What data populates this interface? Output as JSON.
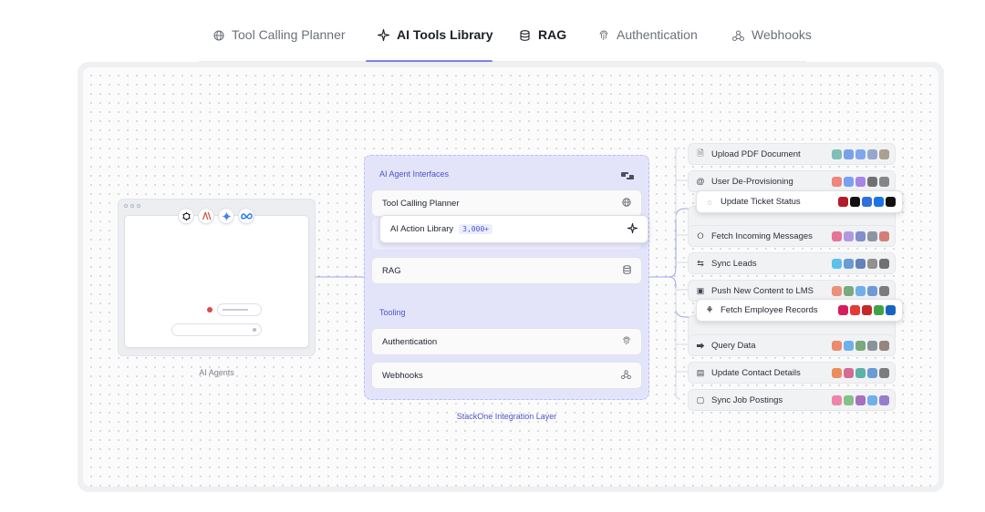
{
  "tabs": [
    {
      "label": "Tool Calling Planner",
      "icon": "globe-icon",
      "active": false
    },
    {
      "label": "AI Tools Library",
      "icon": "sparkle-icon",
      "active": true
    },
    {
      "label": "RAG",
      "icon": "database-icon",
      "active": false
    },
    {
      "label": "Authentication",
      "icon": "fingerprint-icon",
      "active": false
    },
    {
      "label": "Webhooks",
      "icon": "webhook-icon",
      "active": false
    }
  ],
  "agents": {
    "caption": "AI Agents",
    "models": [
      "openai-icon",
      "anthropic-icon",
      "gemini-icon",
      "meta-icon"
    ]
  },
  "layer": {
    "section1_title": "AI Agent Interfaces",
    "section2_title": "Tooling",
    "cards": {
      "tool_calling": "Tool Calling Planner",
      "action_library": "AI Action Library",
      "action_count": "3,000+",
      "rag": "RAG",
      "authentication": "Authentication",
      "webhooks": "Webhooks"
    },
    "caption": "StackOne Integration Layer"
  },
  "actions": [
    {
      "label": "Upload PDF Document",
      "icon": "document-icon",
      "apps": [
        "#3a9e8f",
        "#2f6fde",
        "#3a78e8",
        "#5a79b8",
        "#7c6d4f"
      ]
    },
    {
      "label": "User De-Provisioning",
      "icon": "at-icon",
      "apps": [
        "#ea4335",
        "#2e6ff0",
        "#7b3fe4",
        "#222222",
        "#444444"
      ]
    },
    {
      "label": "Update Ticket Status",
      "icon": "spinner-icon",
      "apps": [
        "#b51a2b",
        "#111111",
        "#2f6fde",
        "#1a73e8",
        "#111111"
      ],
      "raised": true
    },
    {
      "label": "Fetch Incoming Messages",
      "icon": "chat-icon",
      "apps": [
        "#e0245e",
        "#8a63d2",
        "#3f51b5",
        "#4e5d6c",
        "#c0392b"
      ]
    },
    {
      "label": "Sync Leads",
      "icon": "sync-icon",
      "apps": [
        "#00a1e0",
        "#1565c0",
        "#0b3d91",
        "#555555",
        "#222222"
      ]
    },
    {
      "label": "Push New Content to LMS",
      "icon": "board-icon",
      "apps": [
        "#e8542f",
        "#2e7d32",
        "#1e88e5",
        "#1e63c6",
        "#333333"
      ]
    },
    {
      "label": "Fetch Employee Records",
      "icon": "people-icon",
      "apps": [
        "#d81b60",
        "#e53935",
        "#c62828",
        "#43a047",
        "#1565c0"
      ],
      "raised": true
    },
    {
      "label": "Query Data",
      "icon": "nodes-icon",
      "apps": [
        "#e64a19",
        "#1e88e5",
        "#2e7d32",
        "#455a64",
        "#5d4037"
      ]
    },
    {
      "label": "Update Contact Details",
      "icon": "contact-icon",
      "apps": [
        "#e65100",
        "#c2185b",
        "#00897b",
        "#1565c0",
        "#333333"
      ]
    },
    {
      "label": "Sync Job Postings",
      "icon": "briefcase-icon",
      "apps": [
        "#ec407a",
        "#43a047",
        "#7b1fa2",
        "#1e88e5",
        "#5e35b1"
      ]
    }
  ]
}
